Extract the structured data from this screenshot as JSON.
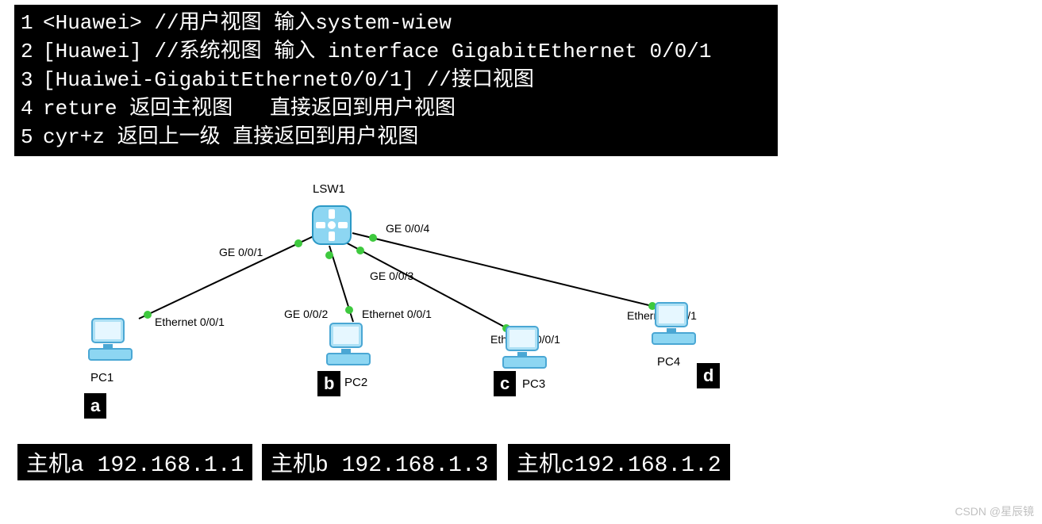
{
  "code": {
    "l1": "<Huawei> //用户视图 输入system-wiew",
    "l2": "[Huawei] //系统视图 输入 interface GigabitEthernet 0/0/1",
    "l3": "[Huaiwei-GigabitEthernet0/0/1] //接口视图",
    "l4": "reture 返回主视图   直接返回到用户视图",
    "l5": "cyr+z 返回上一级 直接返回到用户视图"
  },
  "switch": {
    "name": "LSW1"
  },
  "ports": {
    "ge1": "GE 0/0/1",
    "ge2": "GE 0/0/2",
    "ge3": "GE 0/0/3",
    "ge4": "GE 0/0/4",
    "eth": "Ethernet 0/0/1"
  },
  "pcs": {
    "pc1": {
      "name": "PC1",
      "tag": "a"
    },
    "pc2": {
      "name": "PC2",
      "tag": "b"
    },
    "pc3": {
      "name": "PC3",
      "tag": "c"
    },
    "pc4": {
      "name": "PC4",
      "tag": "d"
    }
  },
  "hosts": {
    "a": "主机a 192.168.1.1",
    "b": "主机b 192.168.1.3",
    "c": "主机c192.168.1.2"
  },
  "watermark": "CSDN @星辰镜"
}
